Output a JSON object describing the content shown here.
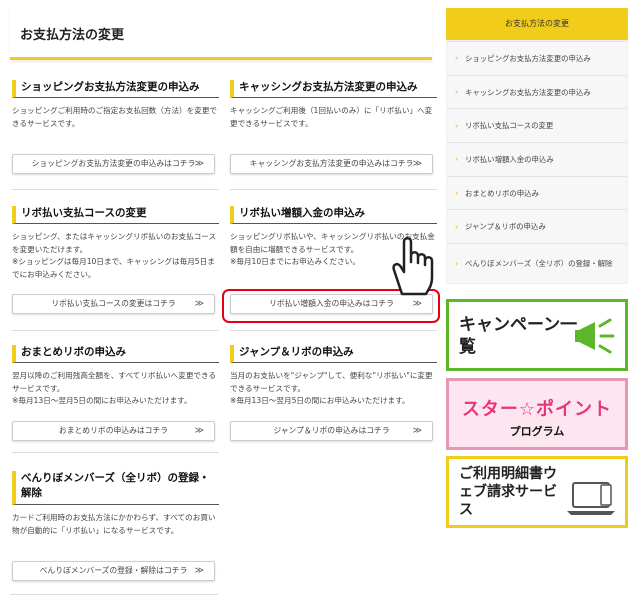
{
  "page_title": "お支払方法の変更",
  "sections": [
    {
      "heading": "ショッピングお支払方法変更の申込み",
      "desc": "ショッピングご利用時のご指定お支払回数（方法）を変更できるサービスです。",
      "notes": [],
      "button": "ショッピングお支払方法変更の申込みはコチラ"
    },
    {
      "heading": "キャッシングお支払方法変更の申込み",
      "desc": "キャッシングご利用後（1回払いのみ）に「リボ払い」へ変更できるサービスです。",
      "notes": [],
      "button": "キャッシングお支払方法変更の申込みはコチラ"
    },
    {
      "heading": "リボ払い支払コースの変更",
      "desc": "ショッピング、またはキャッシングリボ払いのお支払コースを変更いただけます。",
      "notes": [
        "※ショッピングは毎月10日まで、キャッシングは毎月5日までにお申込みください。"
      ],
      "button": "リボ払い支払コースの変更はコチラ"
    },
    {
      "heading": "リボ払い増額入金の申込み",
      "desc": "ショッピングリボ払いや、キャッシングリボ払いのお支払金額を自由に増額できるサービスです。",
      "notes": [
        "※毎月10日までにお申込みください。"
      ],
      "button": "リボ払い増額入金の申込みはコチラ"
    },
    {
      "heading": "おまとめリボの申込み",
      "desc": "翌月以降のご利用残高全額を、すべてリボ払いへ変更できるサービスです。",
      "notes": [
        "※毎月13日～翌月5日の間にお申込みいただけます。"
      ],
      "button": "おまとめリボの申込みはコチラ"
    },
    {
      "heading": "ジャンプ＆リボの申込み",
      "desc": "当月のお支払いを\"ジャンプ\"して、便利な\"リボ払い\"に変更できるサービスです。",
      "notes": [
        "※毎月13日～翌月5日の間にお申込みいただけます。"
      ],
      "button": "ジャンプ＆リボの申込みはコチラ"
    },
    {
      "heading": "べんりぼメンバーズ（全リボ）の登録・解除",
      "desc": "カードご利用時のお支払方法にかかわらず、すべてのお買い物が自動的に「リボ払い」になるサービスです。",
      "notes": [],
      "button": "べんりぼメンバーズの登録・解除はコチラ"
    }
  ],
  "sidebar": {
    "title": "お支払方法の変更",
    "items": [
      "ショッピングお支払方法変更の申込み",
      "キャッシングお支払方法変更の申込み",
      "リボ払い支払コースの変更",
      "リボ払い増額入金の申込み",
      "おまとめリボの申込み",
      "ジャンプ＆リボの申込み",
      "べんりぼメンバーズ（全リボ）の登録・解除"
    ]
  },
  "banners": {
    "campaign": "キャンペーン一覧",
    "star_point_1": "スター☆ポイント",
    "star_point_2": "プログラム",
    "statement": "ご利用明細書ウェブ請求サービス"
  },
  "arrow_glyph": "≫",
  "chevron_glyph": "›",
  "colors": {
    "accent": "#f2cc1a",
    "highlight": "#e60012",
    "green": "#5cb82a",
    "pink": "#e8347a"
  }
}
